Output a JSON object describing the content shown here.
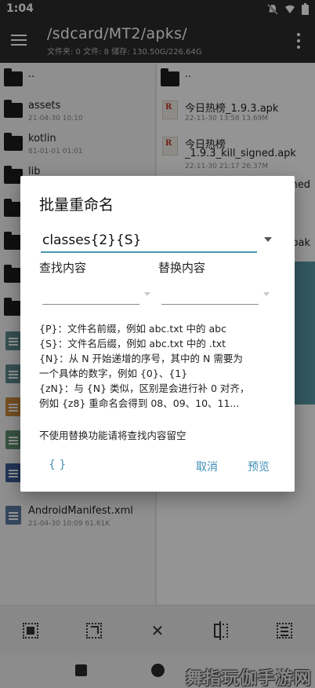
{
  "status_bar": {
    "time": "1:04",
    "icons": [
      "notifications-off-icon",
      "wifi-icon",
      "battery-icon"
    ]
  },
  "app_bar": {
    "path": "/sdcard/MT2/apks/",
    "subtitle": "文件夹: 0  文件: 8  储存: 130.50G/226.64G"
  },
  "left_panel": {
    "items": [
      {
        "name": "..",
        "meta": "",
        "icon": "folder-icon"
      },
      {
        "name": "assets",
        "meta": "21-04-30 10:10",
        "icon": "folder-icon"
      },
      {
        "name": "kotlin",
        "meta": "81-01-01 01:01",
        "icon": "folder-icon"
      },
      {
        "name": "lib",
        "meta": "",
        "icon": "folder-icon"
      },
      {
        "name": "",
        "meta": "",
        "icon": "folder-icon"
      },
      {
        "name": "",
        "meta": "",
        "icon": "folder-icon"
      },
      {
        "name": "",
        "meta": "",
        "icon": "folder-icon"
      },
      {
        "name": "",
        "meta": "",
        "icon": "folder-icon"
      },
      {
        "name": "",
        "meta": "",
        "icon": "file-icon"
      },
      {
        "name": "",
        "meta": "",
        "icon": "file-icon"
      },
      {
        "name": "",
        "meta": "",
        "icon": "layers-icon"
      },
      {
        "name": "",
        "meta": "",
        "icon": "file-icon"
      },
      {
        "name": "",
        "meta": "",
        "icon": "document-icon"
      },
      {
        "name": "AndroidManifest.xml",
        "meta": "21-04-30 10:09  61.61K",
        "icon": "xml-file-icon"
      }
    ]
  },
  "right_panel": {
    "items": [
      {
        "name": "..",
        "meta": "",
        "icon": "folder-icon"
      },
      {
        "name": "今日热榜_1.9.3.apk",
        "meta": "22-11-30 13:58  13.69M",
        "icon": "apk-icon"
      },
      {
        "name": "今日热榜",
        "name2": "_1.9.3_kill_signed.apk",
        "meta": "22-11-30 21:17  26.37M",
        "icon": "apk-icon"
      },
      {
        "partial": "ned"
      },
      {
        "partial": "bak"
      }
    ]
  },
  "dialog": {
    "title": "批量重命名",
    "pattern_value": "classes{2}{S}",
    "find_label": "查找内容",
    "replace_label": "替换内容",
    "find_value": "",
    "replace_value": "",
    "help_lines": [
      "{P}：文件名前缀，例如 abc.txt 中的 abc",
      "{S}：文件名后缀，例如 abc.txt 中的 .txt",
      "{N}：从 N 开始递增的序号，其中的 N 需要为",
      "一个具体的数字，例如 {0}、{1}",
      "{zN}：与 {N} 类似，区别是会进行补 0 对齐，",
      "例如 {z8} 重命名会得到 08、09、10、11..."
    ],
    "note": "不使用替换功能请将查找内容留空",
    "btn_braces": "{ }",
    "btn_cancel": "取消",
    "btn_preview": "预览",
    "accent_color": "#3f90b6"
  },
  "bottom_toolbar": {
    "buttons": [
      "select-all-icon",
      "select-range-icon",
      "close-icon",
      "split-view-icon",
      "list-select-icon"
    ]
  },
  "nav_bar": {
    "watermark": "舞指玩伽手游网"
  }
}
